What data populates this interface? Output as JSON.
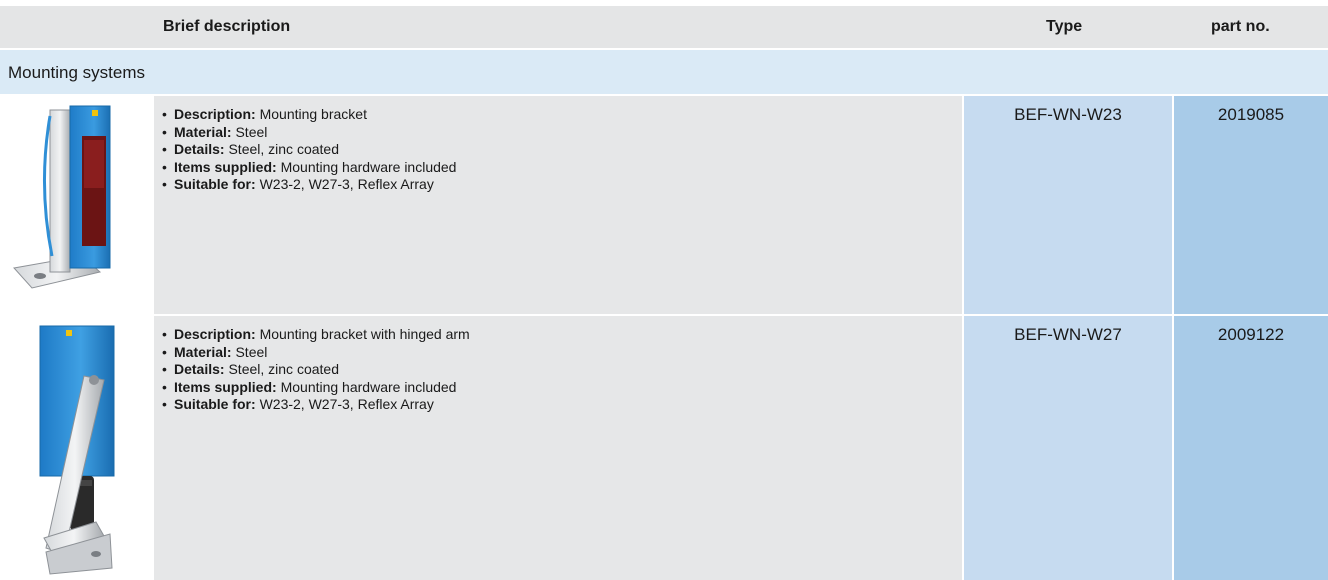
{
  "header": {
    "brief_description": "Brief description",
    "type": "Type",
    "part_no": "part no."
  },
  "section": {
    "title": "Mounting systems"
  },
  "rows": [
    {
      "items": [
        {
          "label": "Description:",
          "value": "Mounting bracket"
        },
        {
          "label": "Material:",
          "value": "Steel"
        },
        {
          "label": "Details:",
          "value": "Steel, zinc coated"
        },
        {
          "label": "Items supplied:",
          "value": "Mounting hardware included"
        },
        {
          "label": "Suitable for:",
          "value": "W23-2, W27-3, Reflex Array"
        }
      ],
      "type": "BEF-WN-W23",
      "part_no": "2019085",
      "image_icon": "sensor-bracket-image"
    },
    {
      "items": [
        {
          "label": "Description:",
          "value": "Mounting bracket with hinged arm"
        },
        {
          "label": "Material:",
          "value": "Steel"
        },
        {
          "label": "Details:",
          "value": "Steel, zinc coated"
        },
        {
          "label": "Items supplied:",
          "value": "Mounting hardware included"
        },
        {
          "label": "Suitable for:",
          "value": "W23-2, W27-3, Reflex Array"
        }
      ],
      "type": "BEF-WN-W27",
      "part_no": "2009122",
      "image_icon": "sensor-hinged-bracket-image"
    }
  ],
  "colors": {
    "header_bg": "#e4e5e6",
    "section_bg": "#daeaf6",
    "desc_bg": "#e6e7e8",
    "type_bg": "#c6dbf0",
    "part_bg": "#a8cbe8",
    "sensor_blue": "#2f8fd6"
  }
}
